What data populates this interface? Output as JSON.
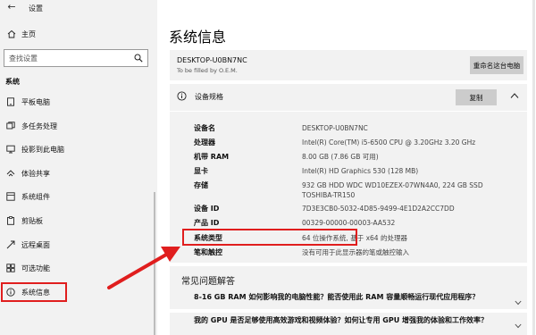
{
  "window": {
    "title": "设置"
  },
  "sidebar": {
    "home_label": "主页",
    "search": {
      "placeholder": "查找设置"
    },
    "section_label": "系统",
    "items": [
      {
        "label": "平板电脑",
        "icon": "tablet-icon"
      },
      {
        "label": "多任务处理",
        "icon": "multitask-icon"
      },
      {
        "label": "投影到此电脑",
        "icon": "project-icon"
      },
      {
        "label": "体验共享",
        "icon": "share-icon"
      },
      {
        "label": "系统组件",
        "icon": "components-icon"
      },
      {
        "label": "剪贴板",
        "icon": "clipboard-icon"
      },
      {
        "label": "远程桌面",
        "icon": "remote-desktop-icon"
      },
      {
        "label": "可选功能",
        "icon": "optional-features-icon"
      },
      {
        "label": "系统信息",
        "icon": "info-icon",
        "active": true
      }
    ]
  },
  "main": {
    "title": "系统信息",
    "device": {
      "name": "DESKTOP-U0BN7NC",
      "subtitle": "To be filled by O.E.M.",
      "rename_label": "重命名这台电脑"
    },
    "specs": {
      "title": "设备规格",
      "copy_label": "复制",
      "rows": [
        {
          "key": "设备名",
          "value": "DESKTOP-U0BN7NC"
        },
        {
          "key": "处理器",
          "value": "Intel(R) Core(TM) i5-6500 CPU @ 3.20GHz   3.20 GHz"
        },
        {
          "key": "机带 RAM",
          "value": "8.00 GB (7.86 GB 可用)"
        },
        {
          "key": "显卡",
          "value": "Intel(R) HD Graphics 530 (128 MB)"
        },
        {
          "key": "存储",
          "value": "932 GB HDD WDC WD10EZEX-07WN4A0, 224 GB SSD TOSHIBA-TR150"
        },
        {
          "key": "设备 ID",
          "value": "7D3E3CB0-5032-4D85-9499-4E1D2A2CC7DD"
        },
        {
          "key": "产品 ID",
          "value": "00329-00000-00003-AA532"
        },
        {
          "key": "系统类型",
          "value": "64 位操作系统, 基于 x64 的处理器"
        },
        {
          "key": "笔和触控",
          "value": "没有可用于此显示器的笔或触控输入"
        }
      ]
    },
    "faq": {
      "title": "常见问题解答",
      "questions": [
        "8-16 GB RAM 如何影响我的电脑性能？能否使用此 RAM 容量顺畅运行现代应用程序？",
        "我的 GPU 是否足够使用高效游戏和视频体验？如何让专用 GPU 增强我的体验和工作效率？"
      ]
    }
  },
  "colors": {
    "highlight": "#e01e1e",
    "sidebar_bg": "#f2f2f2",
    "button_bg": "#cccccc"
  }
}
